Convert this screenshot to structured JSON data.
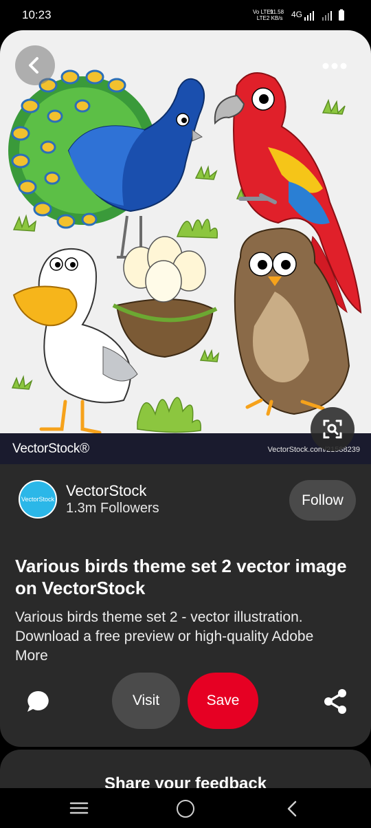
{
  "status_bar": {
    "time": "10:23",
    "network_line1": "Vo LTE1",
    "network_line2": "LTE2",
    "speed_value": "91.58",
    "speed_unit": "KB/s",
    "signal_label": "4G"
  },
  "hero": {
    "watermark_logo": "VectorStock®",
    "watermark_url": "VectorStock.com/21588239"
  },
  "publisher": {
    "avatar_text": "VectorStock",
    "name": "VectorStock",
    "followers": "1.3m Followers",
    "follow_label": "Follow"
  },
  "pin": {
    "title": "Various birds theme set 2 vector image on VectorStock",
    "description": "Various birds theme set 2 - vector illustration. Download a free preview or high-quality Adobe",
    "more_label": "More"
  },
  "actions": {
    "visit_label": "Visit",
    "save_label": "Save"
  },
  "feedback": {
    "title": "Share your feedback"
  },
  "icons": {
    "back": "chevron-left-icon",
    "more": "more-horizontal-icon",
    "lens": "visual-search-icon",
    "comment": "comment-icon",
    "share": "share-icon"
  },
  "colors": {
    "save": "#e60023",
    "card": "#2a2a2a",
    "avatar": "#2bb7e8"
  }
}
